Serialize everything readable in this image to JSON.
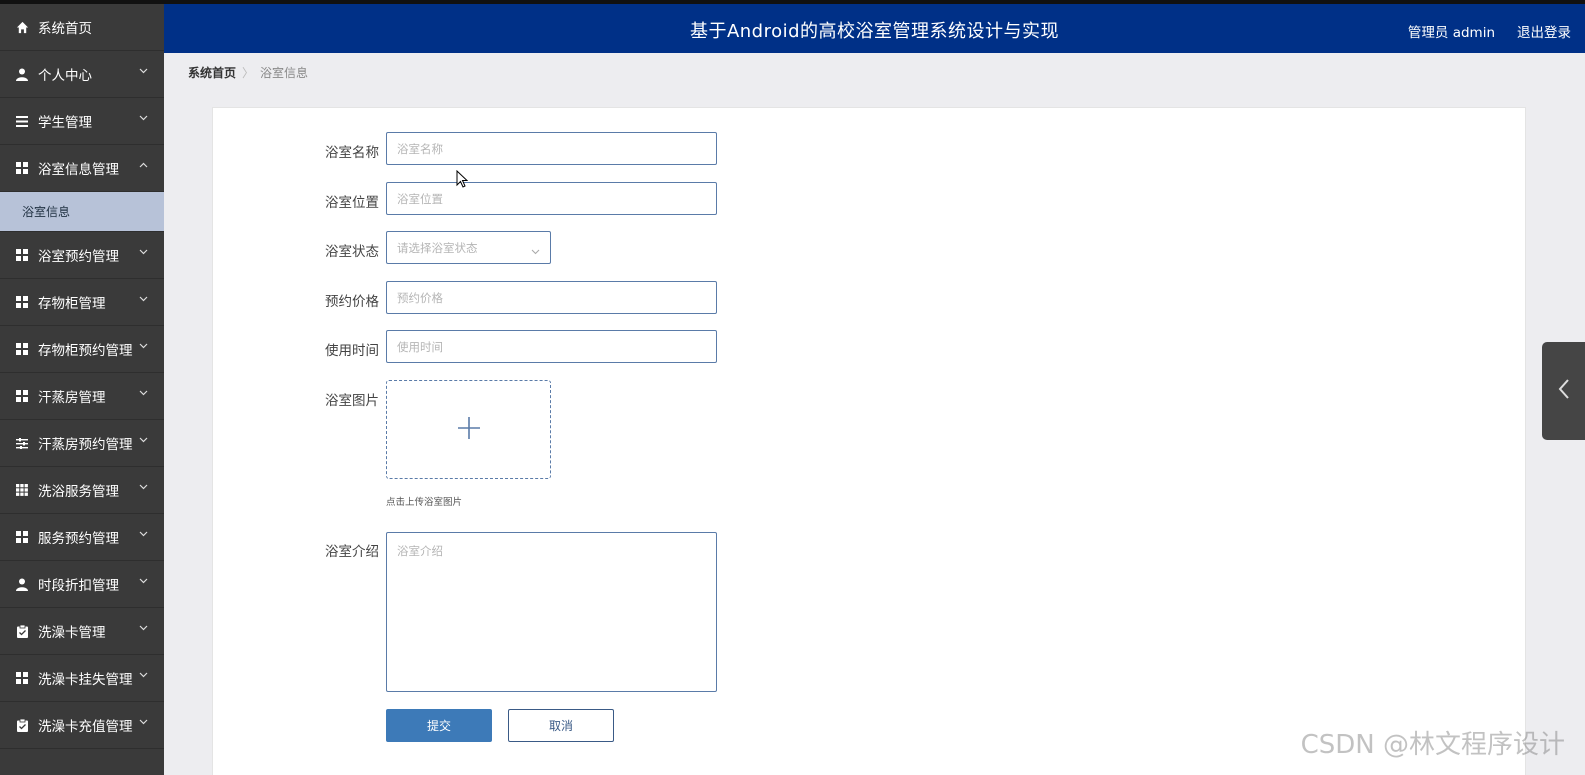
{
  "app": {
    "title": "基于Android的高校浴室管理系统设计与实现",
    "user_label": "管理员 admin",
    "logout_label": "退出登录"
  },
  "sidebar": {
    "items": [
      {
        "label": "系统首页",
        "icon": "home-icon"
      },
      {
        "label": "个人中心",
        "icon": "user-icon"
      },
      {
        "label": "学生管理",
        "icon": "list-icon"
      },
      {
        "label": "浴室信息管理",
        "icon": "grid-icon",
        "expanded": true
      },
      {
        "label": "浴室预约管理",
        "icon": "grid-icon"
      },
      {
        "label": "存物柜管理",
        "icon": "grid-icon"
      },
      {
        "label": "存物柜预约管理",
        "icon": "grid-icon"
      },
      {
        "label": "汗蒸房管理",
        "icon": "grid-icon"
      },
      {
        "label": "汗蒸房预约管理",
        "icon": "sliders-icon"
      },
      {
        "label": "洗浴服务管理",
        "icon": "table-icon"
      },
      {
        "label": "服务预约管理",
        "icon": "grid-icon"
      },
      {
        "label": "时段折扣管理",
        "icon": "user-icon"
      },
      {
        "label": "洗澡卡管理",
        "icon": "clipboard-icon"
      },
      {
        "label": "洗澡卡挂失管理",
        "icon": "grid-icon"
      },
      {
        "label": "洗澡卡充值管理",
        "icon": "clipboard-icon"
      }
    ],
    "sub_item": "浴室信息"
  },
  "breadcrumb": {
    "home": "系统首页",
    "separator": "〉",
    "current": "浴室信息"
  },
  "form": {
    "name_label": "浴室名称",
    "name_placeholder": "浴室名称",
    "location_label": "浴室位置",
    "location_placeholder": "浴室位置",
    "status_label": "浴室状态",
    "status_placeholder": "请选择浴室状态",
    "price_label": "预约价格",
    "price_placeholder": "预约价格",
    "time_label": "使用时间",
    "time_placeholder": "使用时间",
    "image_label": "浴室图片",
    "image_tip": "点击上传浴室图片",
    "intro_label": "浴室介绍",
    "intro_placeholder": "浴室介绍",
    "submit_label": "提交",
    "cancel_label": "取消"
  },
  "watermark": "CSDN @林文程序设计",
  "colors": {
    "header_bg": "#003087",
    "sidebar_bg": "#3a3a3a",
    "active_sub_bg": "#b7c2d8",
    "submit_bg": "#3d7ab8"
  }
}
